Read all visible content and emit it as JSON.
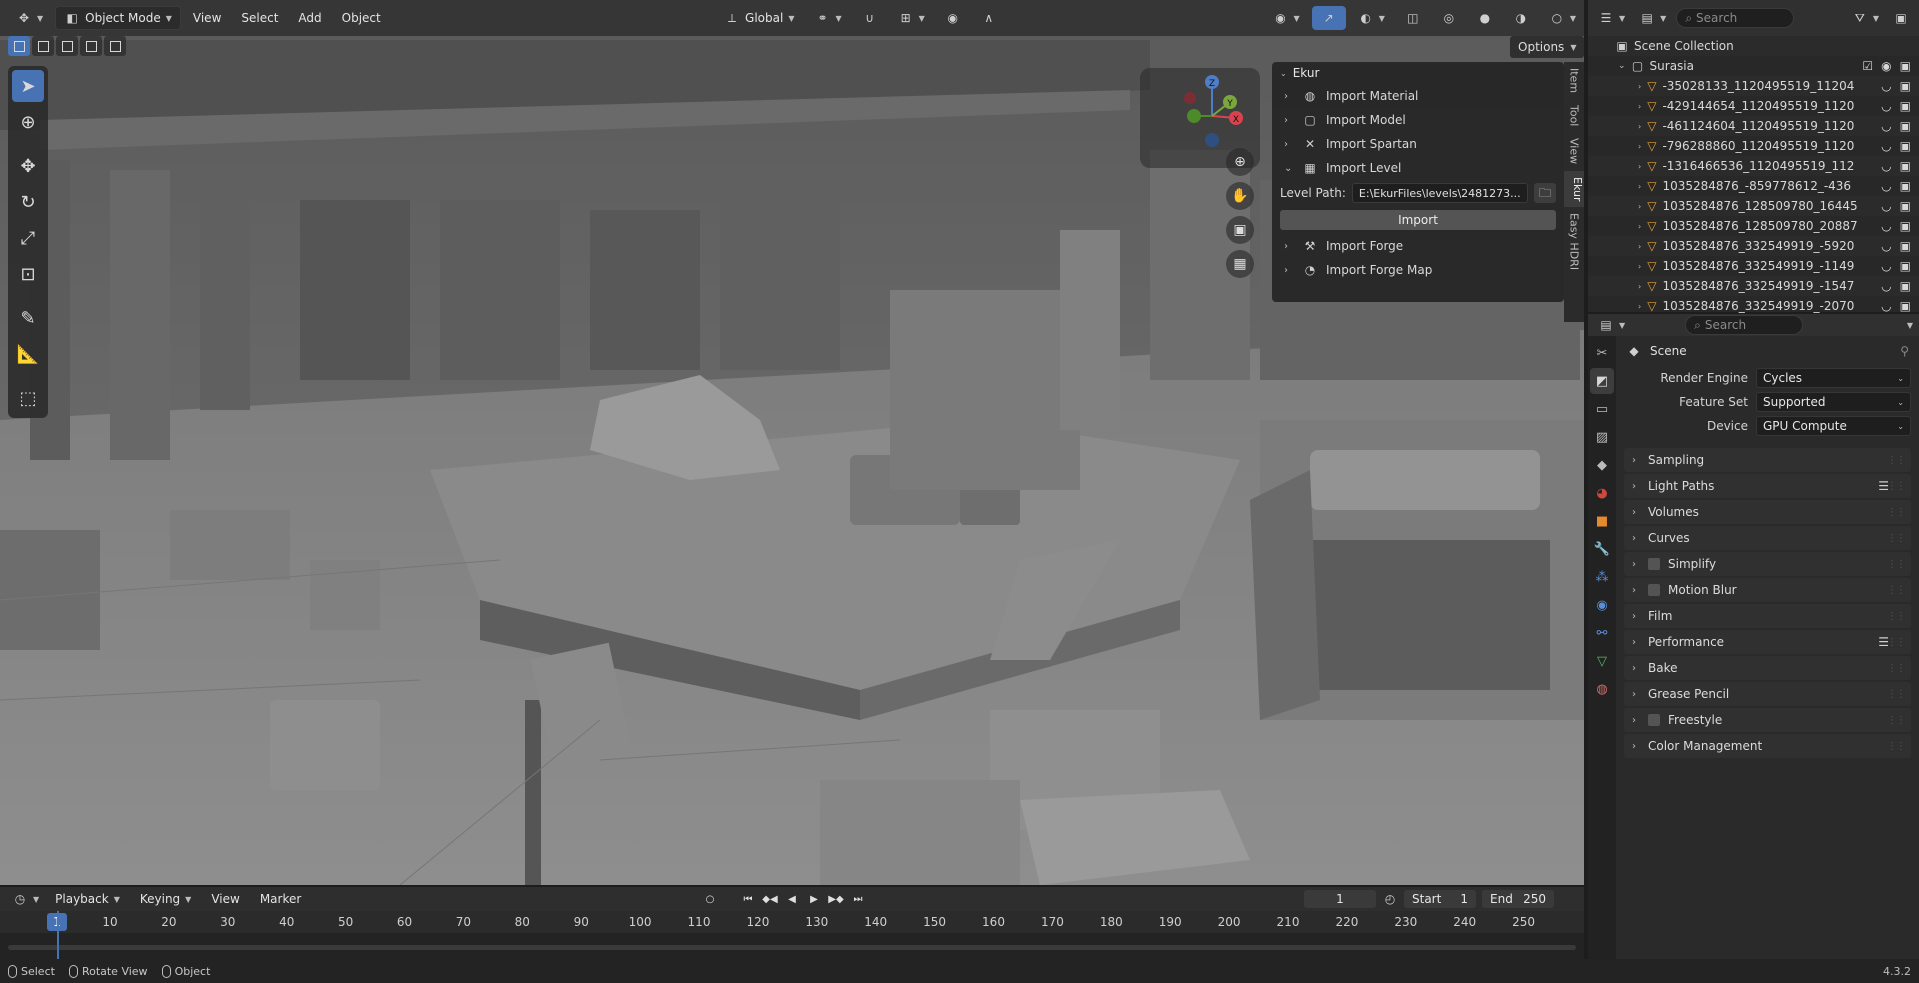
{
  "viewport": {
    "header": {
      "mode": "Object Mode",
      "menus": [
        "View",
        "Select",
        "Add",
        "Object"
      ],
      "transform_orientation": "Global"
    },
    "options_label": "Options",
    "tools": [
      "select-box",
      "cursor",
      "move",
      "rotate",
      "scale",
      "transform",
      "annotate",
      "measure",
      "add-cube"
    ]
  },
  "ekur_panel": {
    "title": "Ekur",
    "items": [
      {
        "label": "Import Material",
        "expanded": false
      },
      {
        "label": "Import Model",
        "expanded": false
      },
      {
        "label": "Import Spartan",
        "expanded": false
      },
      {
        "label": "Import Level",
        "expanded": true
      }
    ],
    "level_path_label": "Level Path:",
    "level_path_value": "E:\\EkurFiles\\levels\\2481273...",
    "import_button": "Import",
    "items_after": [
      {
        "label": "Import Forge"
      },
      {
        "label": "Import Forge Map"
      }
    ],
    "vertical_tabs": [
      "Item",
      "Tool",
      "View",
      "Ekur",
      "Easy HDRI"
    ]
  },
  "gizmo": {
    "x": "X",
    "y": "Y",
    "z": "Z"
  },
  "outliner": {
    "search_placeholder": "Search",
    "scene_collection": "Scene Collection",
    "collection": "Surasia",
    "objects": [
      "-35028133_1120495519_11204",
      "-429144654_1120495519_1120",
      "-461124604_1120495519_1120",
      "-796288860_1120495519_1120",
      "-1316466536_1120495519_112",
      "1035284876_-859778612_-436",
      "1035284876_128509780_16445",
      "1035284876_128509780_20887",
      "1035284876_332549919_-5920",
      "1035284876_332549919_-1149",
      "1035284876_332549919_-1547",
      "1035284876_332549919_-2070"
    ]
  },
  "properties": {
    "search_placeholder": "Search",
    "context": "Scene",
    "fields": [
      {
        "label": "Render Engine",
        "value": "Cycles"
      },
      {
        "label": "Feature Set",
        "value": "Supported"
      },
      {
        "label": "Device",
        "value": "GPU Compute"
      }
    ],
    "sections": [
      {
        "label": "Sampling",
        "checkbox": false,
        "list": false
      },
      {
        "label": "Light Paths",
        "checkbox": false,
        "list": true
      },
      {
        "label": "Volumes",
        "checkbox": false,
        "list": false
      },
      {
        "label": "Curves",
        "checkbox": false,
        "list": false
      },
      {
        "label": "Simplify",
        "checkbox": true,
        "list": false
      },
      {
        "label": "Motion Blur",
        "checkbox": true,
        "list": false
      },
      {
        "label": "Film",
        "checkbox": false,
        "list": false
      },
      {
        "label": "Performance",
        "checkbox": false,
        "list": true
      },
      {
        "label": "Bake",
        "checkbox": false,
        "list": false
      },
      {
        "label": "Grease Pencil",
        "checkbox": false,
        "list": false
      },
      {
        "label": "Freestyle",
        "checkbox": true,
        "list": false
      },
      {
        "label": "Color Management",
        "checkbox": false,
        "list": false
      }
    ]
  },
  "timeline": {
    "menus": [
      "Playback",
      "Keying",
      "View",
      "Marker"
    ],
    "current_frame": "1",
    "start_label": "Start",
    "start_value": "1",
    "end_label": "End",
    "end_value": "250",
    "ticks": [
      "10",
      "20",
      "30",
      "40",
      "50",
      "60",
      "70",
      "80",
      "90",
      "100",
      "110",
      "120",
      "130",
      "140",
      "150",
      "160",
      "170",
      "180",
      "190",
      "200",
      "210",
      "220",
      "230",
      "240",
      "250"
    ],
    "ruler_current": "1"
  },
  "statusbar": {
    "items": [
      "Select",
      "Rotate View",
      "Object"
    ],
    "version": "4.3.2"
  }
}
